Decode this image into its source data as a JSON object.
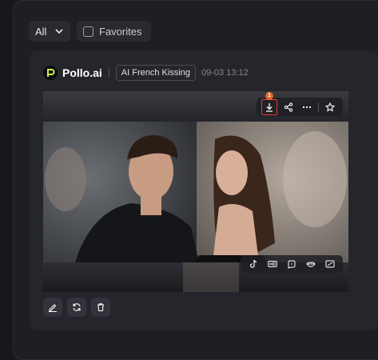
{
  "filters": {
    "select_value": "All",
    "favorites_label": "Favorites"
  },
  "card": {
    "brand": "Pollo.ai",
    "model_tag": "AI French Kissing",
    "timestamp": "09-03 13:12",
    "download_badge": "1"
  },
  "icons": {
    "select_chevron": "chevron-down-icon",
    "favorites_checkbox": "checkbox-icon",
    "logo": "pollo-logo-icon",
    "download": "download-icon",
    "share": "share-icon",
    "more": "more-icon",
    "favorite": "star-icon",
    "tiktok": "tiktok-icon",
    "hd": "hd-icon",
    "lip_sync": "lip-sync-icon",
    "lips": "lips-icon",
    "cast": "cast-icon",
    "edit": "edit-icon",
    "regenerate": "refresh-icon",
    "delete": "trash-icon"
  },
  "colors": {
    "background": "#17181c",
    "panel": "#1e1f24",
    "card": "#25262c",
    "highlight": "#e63a3a",
    "badge": "#e06a2a"
  }
}
